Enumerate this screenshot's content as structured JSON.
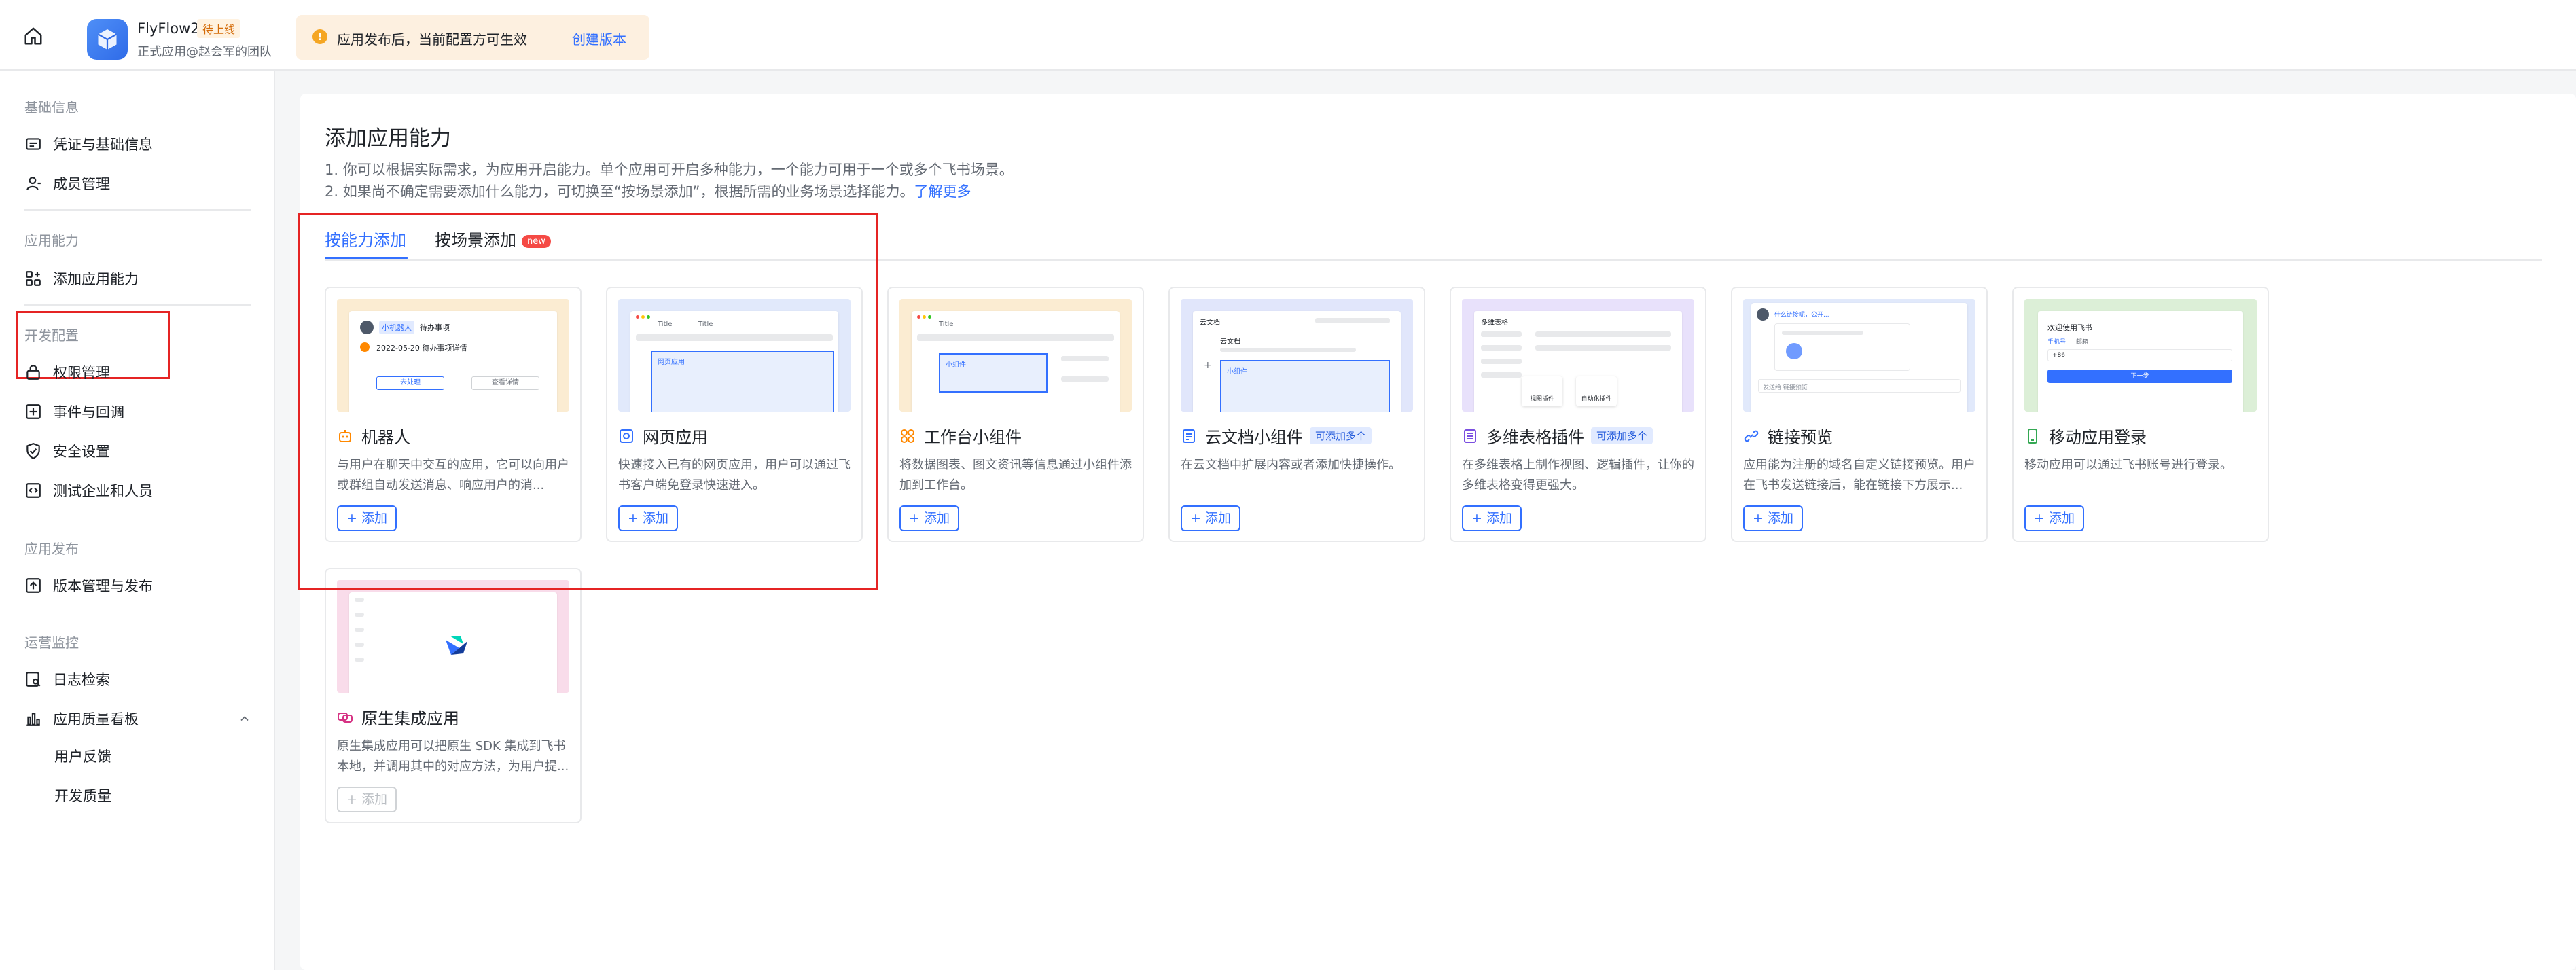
{
  "topbar": {
    "app_name": "FlyFlow2",
    "app_status": "待上线",
    "app_team": "正式应用@赵会军的团队",
    "notice_text": "应用发布后，当前配置方可生效",
    "notice_link": "创建版本"
  },
  "sidebar": {
    "groups": [
      {
        "title": "基础信息",
        "items": [
          "凭证与基础信息",
          "成员管理"
        ]
      },
      {
        "title": "应用能力",
        "items": [
          "添加应用能力"
        ]
      },
      {
        "title": "开发配置",
        "items": [
          "权限管理",
          "事件与回调",
          "安全设置",
          "测试企业和人员"
        ]
      },
      {
        "title": "应用发布",
        "items": [
          "版本管理与发布"
        ]
      },
      {
        "title": "运营监控",
        "items": [
          "日志检索",
          "应用质量看板"
        ],
        "subitems": [
          "用户反馈",
          "开发质量"
        ]
      }
    ]
  },
  "main": {
    "title": "添加应用能力",
    "desc1": "1. 你可以根据实际需求，为应用开启能力。单个应用可开启多种能力，一个能力可用于一个或多个飞书场景。",
    "desc2": "2. 如果尚不确定需要添加什么能力，可切换至“按场景添加”，根据所需的业务场景选择能力。",
    "learn_more": "了解更多",
    "tabs": [
      {
        "label": "按能力添加",
        "active": true
      },
      {
        "label": "按场景添加",
        "badge": "new"
      }
    ],
    "add_label": "+ 添加",
    "multi_tag": "可添加多个",
    "cards": [
      {
        "title": "机器人",
        "desc": "与用户在聊天中交互的应用，它可以向用户或群组自动发送消息、响应用户的消...",
        "icon": "robot-icon",
        "disabled": false
      },
      {
        "title": "网页应用",
        "desc": "快速接入已有的网页应用，用户可以通过飞书客户端免登录快速进入。",
        "icon": "web-app-icon",
        "disabled": false
      },
      {
        "title": "工作台小组件",
        "desc": "将数据图表、图文资讯等信息通过小组件添加到工作台。",
        "icon": "widget-icon",
        "disabled": false
      },
      {
        "title": "云文档小组件",
        "desc": "在云文档中扩展内容或者添加快捷操作。",
        "icon": "doc-widget-icon",
        "multi": true,
        "disabled": false
      },
      {
        "title": "多维表格插件",
        "desc": "在多维表格上制作视图、逻辑插件，让你的多维表格变得更强大。",
        "icon": "bitable-plugin-icon",
        "multi": true,
        "disabled": false
      },
      {
        "title": "链接预览",
        "desc": "应用能为注册的域名自定义链接预览。用户在飞书发送链接后，能在链接下方展示...",
        "icon": "link-icon",
        "disabled": false
      },
      {
        "title": "移动应用登录",
        "desc": "移动应用可以通过飞书账号进行登录。",
        "icon": "mobile-login-icon",
        "disabled": false
      },
      {
        "title": "原生集成应用",
        "desc": "原生集成应用可以把原生 SDK 集成到飞书本地，并调用其中的对应方法，为用户提...",
        "icon": "native-app-icon",
        "disabled": true
      }
    ],
    "previews": {
      "bot_chip": "小机器人",
      "bot_task": "待办事项",
      "bot_date": "2022-05-20 待办事项详情",
      "bot_btn1": "去处理",
      "bot_btn2": "查看详情",
      "web_tab1": "Title",
      "web_tab2": "Title",
      "web_label": "网页应用",
      "widget_tab": "Title",
      "widget_label": "小组件",
      "doc_header": "云文档",
      "doc_title": "云文档",
      "doc_label": "小组件",
      "bitable_header": "多维表格",
      "bitable_view": "视图插件",
      "bitable_auto": "自动化插件",
      "link_msg": "什么链接呢，公开...",
      "link_input": "发送给 链接预览",
      "mobile_title": "欢迎使用飞书",
      "mobile_tab1": "手机号",
      "mobile_tab2": "邮箱",
      "mobile_code": "+86",
      "mobile_btn": "下一步"
    }
  }
}
